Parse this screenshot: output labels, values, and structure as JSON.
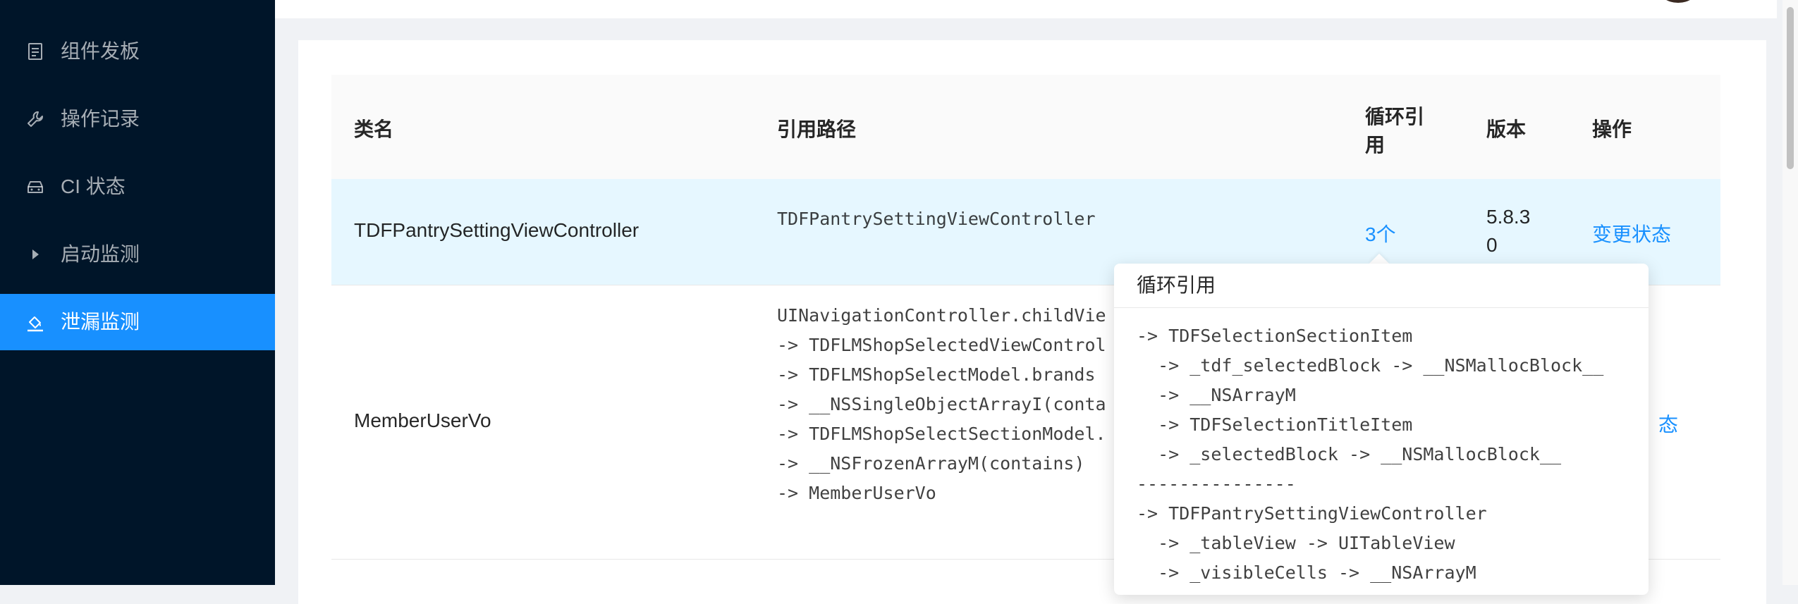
{
  "sidebar": {
    "items": [
      {
        "label": "组件发板",
        "icon": "document-icon",
        "active": false
      },
      {
        "label": "操作记录",
        "icon": "wrench-icon",
        "active": false
      },
      {
        "label": "CI 状态",
        "icon": "car-icon",
        "active": false
      },
      {
        "label": "启动监测",
        "icon": "caret-right-icon",
        "active": false
      },
      {
        "label": "泄漏监测",
        "icon": "paint-bucket-icon",
        "active": true
      }
    ]
  },
  "table": {
    "columns": [
      "类名",
      "引用路径",
      "循环引用",
      "版本",
      "操作"
    ],
    "column_header_wrapped": [
      "循环引",
      "用"
    ],
    "rows": [
      {
        "class_name": "TDFPantrySettingViewController",
        "path": "TDFPantrySettingViewController",
        "cycle": "3个",
        "version_lines": [
          "5.8.3",
          "0"
        ],
        "action": "变更状态"
      },
      {
        "class_name": "MemberUserVo",
        "path_lines": [
          "UINavigationController.childVie",
          "-> TDFLMShopSelectedViewControl",
          "-> TDFLMShopSelectModel.brands",
          "-> __NSSingleObjectArrayI(conta",
          "-> TDFLMShopSelectSectionModel.",
          "-> __NSFrozenArrayM(contains)",
          "-> MemberUserVo"
        ],
        "action_partial": "态"
      }
    ]
  },
  "popover": {
    "title": "循环引用",
    "lines": [
      "-> TDFSelectionSectionItem",
      "  -> _tdf_selectedBlock -> __NSMallocBlock__",
      "  -> __NSArrayM",
      "  -> TDFSelectionTitleItem",
      "  -> _selectedBlock -> __NSMallocBlock__",
      "---------------",
      "-> TDFPantrySettingViewController",
      "  -> _tableView -> UITableView",
      "  -> _visibleCells -> __NSArrayM"
    ]
  },
  "colors": {
    "sidebar_bg": "#001529",
    "accent": "#1890ff",
    "row_hover": "#e6f7ff"
  }
}
